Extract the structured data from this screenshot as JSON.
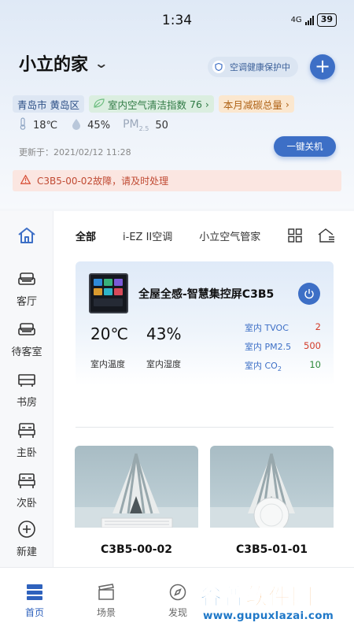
{
  "status_bar": {
    "time": "1:34",
    "network": "4G",
    "battery": "39"
  },
  "header": {
    "home_name": "小立的家",
    "health_status": "空调健康保护中",
    "add_label": "+"
  },
  "info_tags": {
    "location": "青岛市 黄岛区",
    "air_index_label": "室内空气清洁指数",
    "air_index_value": "76",
    "carbon_label": "本月减碳总量"
  },
  "weather": {
    "temperature": "18℃",
    "humidity": "45%",
    "pm_label": "PM",
    "pm_sub": "2.5",
    "pm_value": "50"
  },
  "update": {
    "label": "更新于：",
    "time": "2021/02/12 11:28"
  },
  "shutdown_button": "一键关机",
  "alert": {
    "text": "C3B5-00-02故障，请及时处理"
  },
  "sidebar": {
    "items": [
      {
        "label": "客厅",
        "icon": "sofa-icon"
      },
      {
        "label": "待客室",
        "icon": "sofa-icon"
      },
      {
        "label": "书房",
        "icon": "cabinet-icon"
      },
      {
        "label": "主卧",
        "icon": "bed-icon"
      },
      {
        "label": "次卧",
        "icon": "bed-icon"
      },
      {
        "label": "新建",
        "icon": "plus-circle-icon"
      }
    ]
  },
  "tabs": [
    {
      "label": "全部",
      "active": true
    },
    {
      "label": "i-EZ II空调",
      "active": false
    },
    {
      "label": "小立空气管家",
      "active": false
    }
  ],
  "device_card": {
    "name": "全屋全感-智慧集控屏C3B5",
    "temperature": "20℃",
    "temperature_label": "室内温度",
    "humidity": "43%",
    "humidity_label": "室内湿度",
    "metrics": [
      {
        "label": "室内 TVOC",
        "value": "2",
        "color": "#d23c2a"
      },
      {
        "label": "室内 PM2.5",
        "value": "500",
        "color": "#d23c2a"
      },
      {
        "label": "室内 CO",
        "sub": "2",
        "value": "10",
        "color": "#2f8a3a"
      }
    ]
  },
  "products": [
    {
      "name": "C3B5-00-02"
    },
    {
      "name": "C3B5-01-01"
    }
  ],
  "bottom_nav": [
    {
      "label": "首页",
      "active": true
    },
    {
      "label": "场景",
      "active": false
    },
    {
      "label": "发现",
      "active": false
    }
  ],
  "watermark": {
    "text_1": "谷普",
    "text_2": "软件园",
    "url": "www.gupuxlazai.com"
  },
  "colors": {
    "accent": "#3d6fc6",
    "alert_bg": "#fbe6e1",
    "alert_text": "#c04a33"
  }
}
